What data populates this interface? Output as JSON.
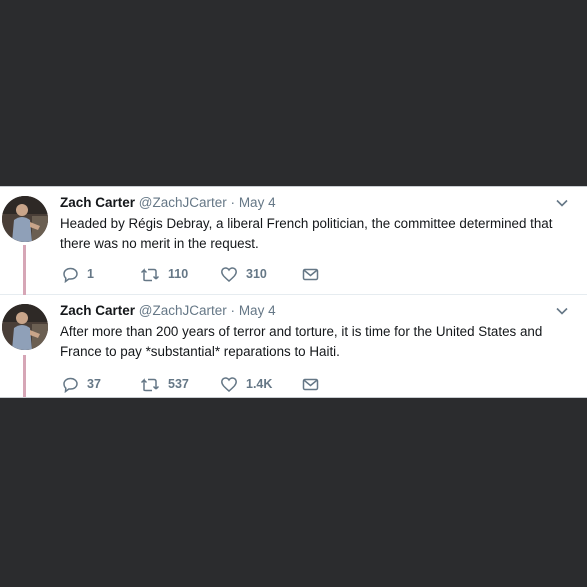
{
  "colors": {
    "background": "#2b2c2e",
    "card": "#ffffff",
    "thread_line": "#d6a6b6",
    "muted": "#657786",
    "text": "#14171a"
  },
  "tweets": [
    {
      "name": "Zach Carter",
      "handle": "@ZachJCarter",
      "date": "May 4",
      "text": "Headed by Régis Debray, a liberal French politician, the committee determined that there was no merit in the request.",
      "replies": "1",
      "retweets": "110",
      "likes": "310"
    },
    {
      "name": "Zach Carter",
      "handle": "@ZachJCarter",
      "date": "May 4",
      "text": "After more than 200 years of terror and torture, it is time for the United States and France to pay *substantial* reparations to Haiti.",
      "replies": "37",
      "retweets": "537",
      "likes": "1.4K"
    }
  ],
  "icons": {
    "reply": "reply-icon",
    "retweet": "retweet-icon",
    "like": "heart-icon",
    "message": "envelope-icon",
    "more": "chevron-down-icon"
  }
}
